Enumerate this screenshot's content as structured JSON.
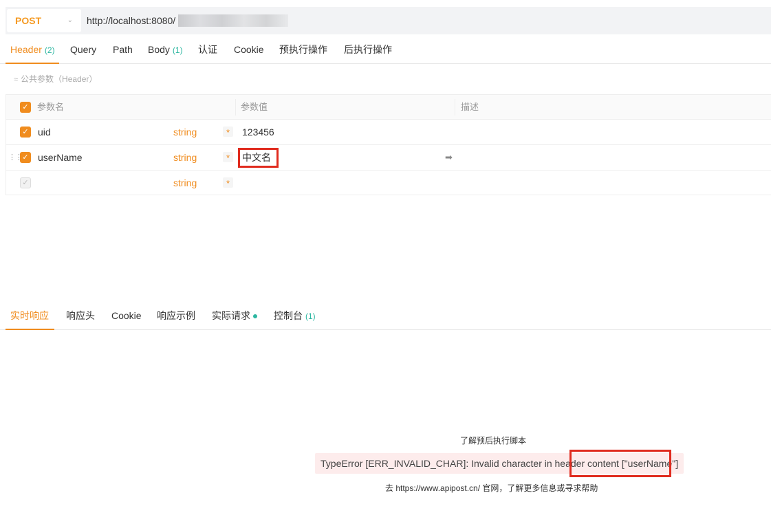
{
  "request": {
    "method": "POST",
    "url": "http://localhost:8080/"
  },
  "request_tabs": [
    {
      "label": "Header",
      "count": "(2)"
    },
    {
      "label": "Query"
    },
    {
      "label": "Path"
    },
    {
      "label": "Body",
      "count": "(1)"
    },
    {
      "label": "认证"
    },
    {
      "label": "Cookie"
    },
    {
      "label": "预执行操作"
    },
    {
      "label": "后执行操作"
    }
  ],
  "public_params": "公共参数（Header）",
  "table": {
    "columns": [
      "参数名",
      "参数值",
      "描述"
    ],
    "rows": [
      {
        "name": "uid",
        "type": "string",
        "required": "*",
        "value": "123456"
      },
      {
        "name": "userName",
        "type": "string",
        "required": "*",
        "value": "中文名"
      },
      {
        "name": "",
        "type": "string",
        "required": "*",
        "value": ""
      }
    ]
  },
  "response_tabs": [
    {
      "label": "实时响应"
    },
    {
      "label": "响应头"
    },
    {
      "label": "Cookie"
    },
    {
      "label": "响应示例"
    },
    {
      "label": "实际请求"
    },
    {
      "label": "控制台",
      "count": "(1)"
    }
  ],
  "response": {
    "learn_link": "了解预后执行脚本",
    "error": "TypeError [ERR_INVALID_CHAR]: Invalid character in header content [\"userName\"]",
    "help_text": "去 https://www.apipost.cn/ 官网，了解更多信息或寻求帮助"
  },
  "colors": {
    "accent": "#f08c1e",
    "count_green": "#2db7a1",
    "highlight_red": "#e02b1e",
    "error_bg": "#fdecec"
  }
}
